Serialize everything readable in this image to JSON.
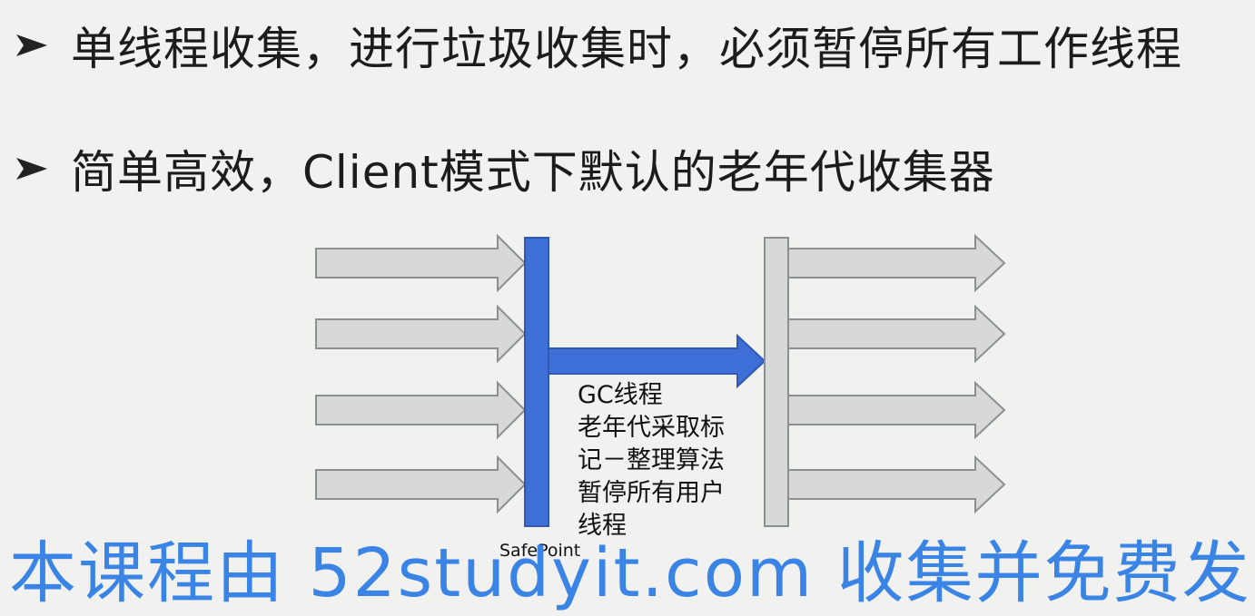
{
  "bullets": [
    {
      "icon": "chevron-arrow-icon",
      "text": "单线程收集，进行垃圾收集时，必须暂停所有工作线程"
    },
    {
      "icon": "chevron-arrow-icon",
      "text": "简单高效，Client模式下默认的老年代收集器"
    }
  ],
  "diagram": {
    "note_lines": [
      "GC线程",
      "老年代采取标",
      "记－整理算法",
      "暂停所有用户",
      "线程"
    ],
    "safepoint_label": "SafePoint",
    "colors": {
      "thread_arrow_fill": "#d7d9d9",
      "thread_arrow_stroke": "#8a8f91",
      "gc_bar": "#3d6fd6",
      "gc_bar_stroke": "#2f58b0",
      "resume_bar": "#d7d9d9"
    }
  },
  "watermark": {
    "text": "本课程由 52studyit.com 收集并免费发"
  }
}
